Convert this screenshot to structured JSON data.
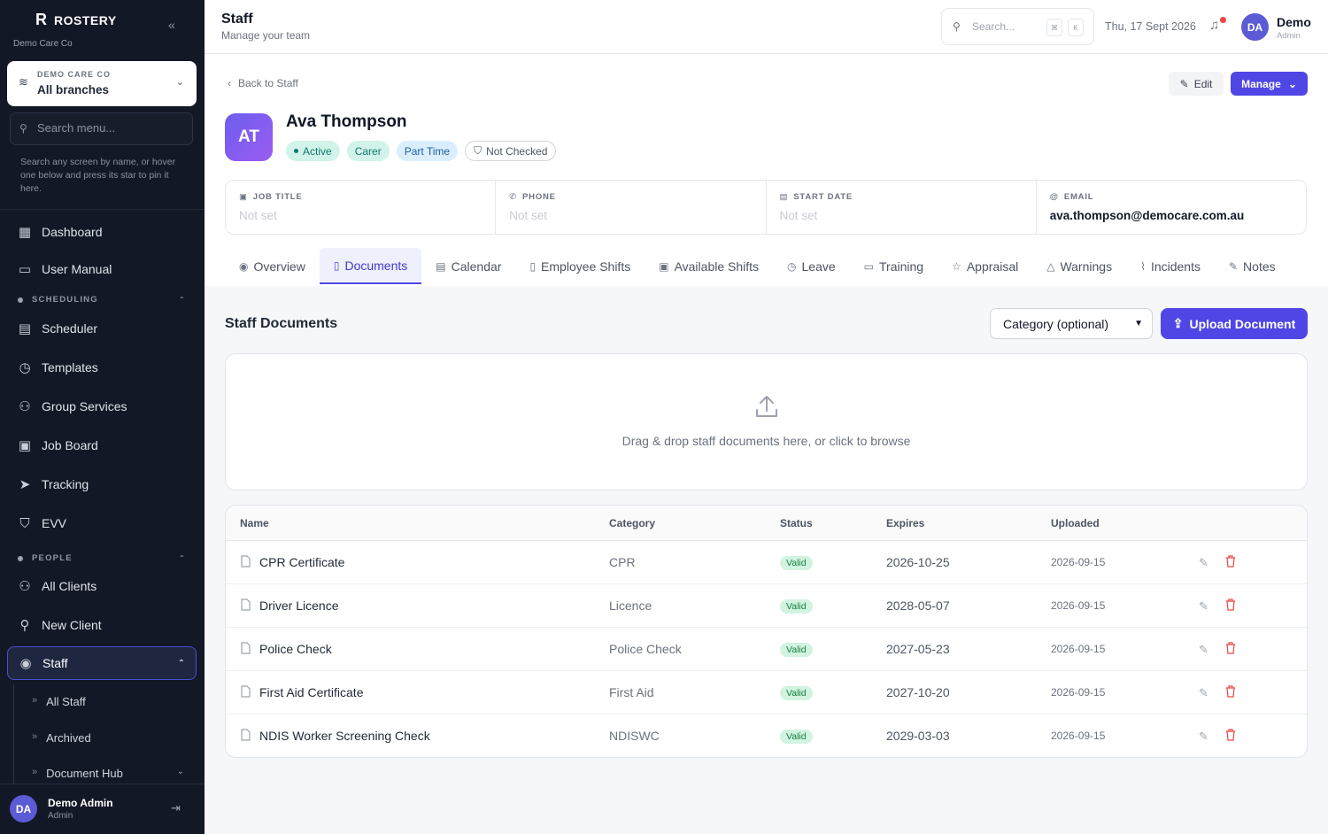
{
  "app": {
    "brand": "ROSTERY",
    "org_sub": "Demo Care Co"
  },
  "branch": {
    "org": "DEMO CARE CO",
    "name": "All branches"
  },
  "sidebar": {
    "search_placeholder": "Search menu...",
    "hint": "Search any screen by name, or hover one below and press its star to pin it here.",
    "items": [
      {
        "label": "Dashboard",
        "icon": "grid-icon"
      },
      {
        "label": "User Manual",
        "icon": "book-icon"
      }
    ],
    "scheduling_label": "SCHEDULING",
    "scheduling": [
      {
        "label": "Scheduler",
        "icon": "calendar-icon"
      },
      {
        "label": "Templates",
        "icon": "calendar-clock-icon"
      },
      {
        "label": "Group Services",
        "icon": "users-icon"
      },
      {
        "label": "Job Board",
        "icon": "briefcase-icon"
      },
      {
        "label": "Tracking",
        "icon": "navigation-icon"
      },
      {
        "label": "EVV",
        "icon": "shield-check-icon"
      }
    ],
    "people_label": "PEOPLE",
    "people": [
      {
        "label": "All Clients",
        "icon": "users-icon"
      },
      {
        "label": "New Client",
        "icon": "user-plus-icon"
      }
    ],
    "staff": {
      "label": "Staff",
      "icon": "user-circle-icon"
    },
    "staff_sub": [
      "All Staff",
      "Archived",
      "Document Hub"
    ],
    "footer": {
      "initials": "DA",
      "name": "Demo Admin",
      "role": "Admin"
    }
  },
  "topbar": {
    "title": "Staff",
    "subtitle": "Manage your team",
    "search_placeholder": "Search...",
    "kbd1": "⌘",
    "kbd2": "K",
    "date": "Thu, 17 Sept 2026",
    "user_initials": "DA",
    "user_name": "Demo",
    "user_role": "Admin"
  },
  "profile": {
    "back": "Back to Staff",
    "edit": "Edit",
    "manage": "Manage",
    "initials": "AT",
    "name": "Ava Thompson",
    "badges": {
      "active": "Active",
      "role": "Carer",
      "type": "Part Time",
      "check": "Not Checked"
    },
    "info": [
      {
        "label": "JOB TITLE",
        "value": "Not set"
      },
      {
        "label": "PHONE",
        "value": "Not set"
      },
      {
        "label": "START DATE",
        "value": "Not set"
      },
      {
        "label": "EMAIL",
        "value": "ava.thompson@democare.com.au"
      }
    ],
    "tabs": [
      "Overview",
      "Documents",
      "Calendar",
      "Employee Shifts",
      "Available Shifts",
      "Leave",
      "Training",
      "Appraisal",
      "Warnings",
      "Incidents",
      "Notes"
    ]
  },
  "documents": {
    "title": "Staff Documents",
    "category_placeholder": "Category (optional)",
    "upload": "Upload Document",
    "drop_msg": "Drag & drop staff documents here, or click to browse",
    "columns": [
      "Name",
      "Category",
      "Status",
      "Expires",
      "Uploaded"
    ],
    "rows": [
      {
        "name": "CPR Certificate",
        "category": "CPR",
        "status": "Valid",
        "expires": "2026-10-25",
        "uploaded": "2026-09-15"
      },
      {
        "name": "Driver Licence",
        "category": "Licence",
        "status": "Valid",
        "expires": "2028-05-07",
        "uploaded": "2026-09-15"
      },
      {
        "name": "Police Check",
        "category": "Police Check",
        "status": "Valid",
        "expires": "2027-05-23",
        "uploaded": "2026-09-15"
      },
      {
        "name": "First Aid Certificate",
        "category": "First Aid",
        "status": "Valid",
        "expires": "2027-10-20",
        "uploaded": "2026-09-15"
      },
      {
        "name": "NDIS Worker Screening Check",
        "category": "NDISWC",
        "status": "Valid",
        "expires": "2029-03-03",
        "uploaded": "2026-09-15"
      }
    ]
  },
  "colors": {
    "accent": "#4f46e5",
    "sidebar_bg": "#131826",
    "valid": "#15803d",
    "danger": "#ef4444"
  }
}
